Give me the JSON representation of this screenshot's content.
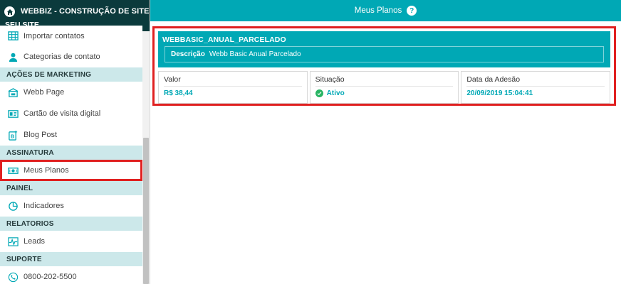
{
  "sidebar": {
    "brand_title": "WEBBIZ - CONSTRUÇÃO DE SITES - CRIE",
    "brand_sub": "SEU SITE",
    "items": [
      {
        "label": "Importar contatos",
        "icon": "table-icon"
      },
      {
        "label": "Categorias de contato",
        "icon": "person-icon"
      },
      {
        "section": "AÇÕES DE MARKETING"
      },
      {
        "label": "Webb Page",
        "icon": "webpage-icon"
      },
      {
        "label": "Cartão de visita digital",
        "icon": "business-card-icon"
      },
      {
        "label": "Blog Post",
        "icon": "blog-post-icon"
      },
      {
        "section": "ASSINATURA"
      },
      {
        "label": "Meus Planos",
        "icon": "money-bill-icon",
        "active": true
      },
      {
        "section": "PAINEL"
      },
      {
        "label": "Indicadores",
        "icon": "pie-chart-icon"
      },
      {
        "section": "RELATORIOS"
      },
      {
        "label": "Leads",
        "icon": "activity-chart-icon"
      },
      {
        "section": "SUPORTE"
      },
      {
        "label": "0800-202-5500",
        "icon": "phone-icon"
      }
    ]
  },
  "header": {
    "title": "Meus Planos",
    "help_glyph": "?"
  },
  "plan": {
    "name": "WEBBASIC_ANUAL_PARCELADO",
    "description_label": "Descrição",
    "description": "Webb Basic Anual Parcelado",
    "stats": {
      "valor_label": "Valor",
      "valor": "R$ 38,44",
      "situacao_label": "Situação",
      "situacao": "Ativo",
      "adesao_label": "Data da Adesão",
      "adesao": "20/09/2019 15:04:41"
    }
  },
  "colors": {
    "brand_dark": "#0b3a3c",
    "accent": "#00a8b5",
    "section_bg": "#cce8ea",
    "highlight": "#e02020",
    "status_ok": "#28b463"
  }
}
